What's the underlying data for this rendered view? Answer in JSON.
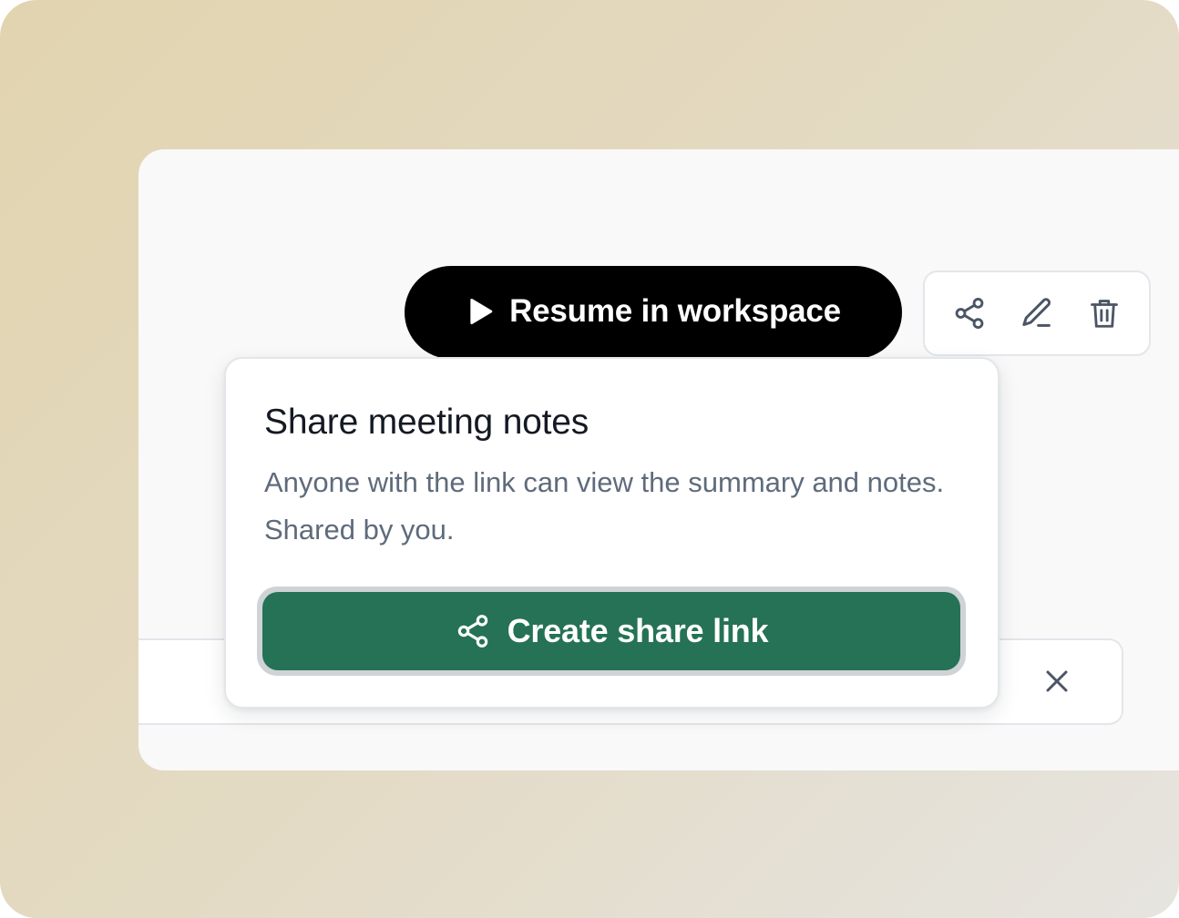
{
  "toolbar": {
    "resume_label": "Resume in workspace",
    "icons": [
      "share-icon",
      "pencil-icon",
      "trash-icon"
    ]
  },
  "share_popover": {
    "title": "Share meeting notes",
    "description": "Anyone with the link can view the summary and notes. Shared by you.",
    "create_button_label": "Create share link"
  },
  "colors": {
    "primary_green": "#257256",
    "resume_bg": "#000000",
    "text_dark": "#141a24",
    "text_muted": "#5f6b7c",
    "icon_gray": "#4b5565"
  }
}
